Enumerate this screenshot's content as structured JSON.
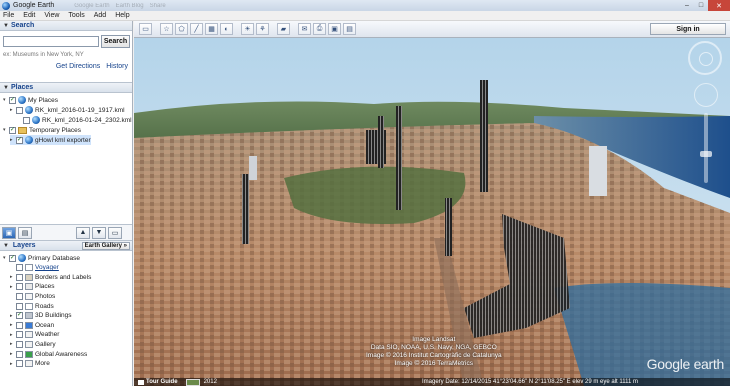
{
  "window": {
    "title": "Google Earth",
    "ghost_tabs": [
      "Google Earth",
      "Earth Blog",
      "Share"
    ],
    "min_glyph": "–",
    "max_glyph": "□",
    "close_glyph": "✕"
  },
  "menu": [
    "File",
    "Edit",
    "View",
    "Tools",
    "Add",
    "Help"
  ],
  "search": {
    "header": "Search",
    "value": "",
    "button": "Search",
    "hint": "ex: Museums in New York, NY",
    "links": [
      "Get Directions",
      "History"
    ]
  },
  "places": {
    "header": "Places",
    "items": [
      {
        "label": "My Places",
        "checked": true,
        "level": 0,
        "expand": "▾",
        "icon": "globe-icon"
      },
      {
        "label": "RK_kml_2016-01-19_1917.kml",
        "checked": false,
        "level": 1,
        "expand": "▸",
        "icon": "globe-icon"
      },
      {
        "label": "RK_kml_2016-01-24_2302.kml",
        "checked": false,
        "level": 2,
        "expand": "",
        "icon": "globe-icon"
      },
      {
        "label": "Temporary Places",
        "checked": true,
        "level": 0,
        "expand": "▾",
        "icon": "folder-icon"
      },
      {
        "label": "gHowl kml exporter",
        "checked": true,
        "level": 1,
        "expand": "▸",
        "icon": "globe-icon",
        "selected": true
      }
    ]
  },
  "places_toolbar": {
    "buttons": [
      "▣",
      "▤",
      "▲",
      "▼",
      "▭"
    ]
  },
  "layers": {
    "header": "Layers",
    "gallery_button": "Earth Gallery »",
    "items": [
      {
        "label": "Primary Database",
        "checked": true,
        "level": 0,
        "expand": "▾",
        "icon": "globe-icon",
        "color": "#2b74c7"
      },
      {
        "label": "Voyager",
        "checked": false,
        "level": 1,
        "expand": "",
        "icon": "voyager-icon",
        "color": "#ffffff",
        "link": true
      },
      {
        "label": "Borders and Labels",
        "checked": false,
        "level": 1,
        "expand": "▸",
        "icon": "borders-icon",
        "color": "#d9d2c0"
      },
      {
        "label": "Places",
        "checked": false,
        "level": 1,
        "expand": "▸",
        "icon": "places-icon",
        "color": "#e9e9e9"
      },
      {
        "label": "Photos",
        "checked": false,
        "level": 1,
        "expand": "",
        "icon": "photos-icon",
        "color": "#f5f5f5"
      },
      {
        "label": "Roads",
        "checked": false,
        "level": 1,
        "expand": "",
        "icon": "roads-icon",
        "color": "#ffffff"
      },
      {
        "label": "3D Buildings",
        "checked": true,
        "level": 1,
        "expand": "▸",
        "icon": "buildings-icon",
        "color": "#c0c6cf"
      },
      {
        "label": "Ocean",
        "checked": false,
        "level": 1,
        "expand": "▸",
        "icon": "ocean-icon",
        "color": "#3a7bd5"
      },
      {
        "label": "Weather",
        "checked": false,
        "level": 1,
        "expand": "▸",
        "icon": "weather-icon",
        "color": "#f2f2f2"
      },
      {
        "label": "Gallery",
        "checked": false,
        "level": 1,
        "expand": "▸",
        "icon": "gallery-icon",
        "color": "#f2f2f2"
      },
      {
        "label": "Global Awareness",
        "checked": false,
        "level": 1,
        "expand": "▸",
        "icon": "awareness-icon",
        "color": "#3aa04a"
      },
      {
        "label": "More",
        "checked": false,
        "level": 1,
        "expand": "▸",
        "icon": "more-icon",
        "color": "#f2f2f2"
      }
    ]
  },
  "map_toolbar": {
    "buttons": [
      "▭",
      "☆",
      "⬠",
      "╱",
      "▦",
      "◐",
      "☀",
      "⚘",
      "▰",
      "✉",
      "⎙",
      "▣",
      "▤"
    ],
    "sign_in": "Sign in"
  },
  "map": {
    "credits_line1": "Image Landsat",
    "credits_line2": "Data SIO, NOAA, U.S. Navy, NGA, GEBCO",
    "credits_line3": "Image © 2016 Institut Cartogràfic de Catalunya",
    "credits_line4": "Image © 2016 TerraMetrics",
    "watermark": "Google earth",
    "tour_guide": "Tour Guide",
    "thumb_year": "2012",
    "status": "Imagery Date: 12/14/2015    41°23'04.66\" N    2°11'08.25\" E    elev  29 m    eye alt 1111 m"
  },
  "colors": {
    "accent": "#15428b",
    "panel_header": "#d9e1eb",
    "close_button": "#c7463a"
  }
}
